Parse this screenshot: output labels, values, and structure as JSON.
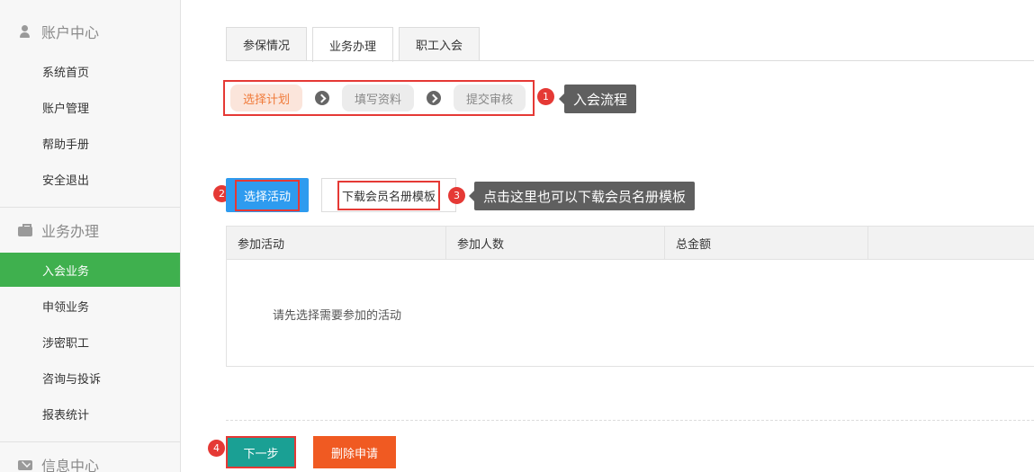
{
  "sidebar": {
    "sections": [
      {
        "title": "账户中心",
        "icon": "user-icon",
        "items": [
          "系统首页",
          "账户管理",
          "帮助手册",
          "安全退出"
        ]
      },
      {
        "title": "业务办理",
        "icon": "briefcase-icon",
        "items": [
          "入会业务",
          "申领业务",
          "涉密职工",
          "咨询与投诉",
          "报表统计"
        ],
        "active_item": "入会业务"
      },
      {
        "title": "信息中心",
        "icon": "envelope-icon",
        "items": []
      }
    ]
  },
  "tabs": [
    {
      "label": "参保情况",
      "active": false
    },
    {
      "label": "业务办理",
      "active": true
    },
    {
      "label": "职工入会",
      "active": false
    }
  ],
  "flow": {
    "steps": [
      "选择计划",
      "填写资料",
      "提交审核"
    ],
    "current_step": "选择计划"
  },
  "annotations": {
    "badge_1": "1",
    "tip_1": "入会流程",
    "badge_2": "2",
    "badge_3": "3",
    "tip_3": "点击这里也可以下载会员名册模板",
    "badge_4": "4"
  },
  "actions": {
    "select_activity": "选择活动",
    "download_template": "下载会员名册模板"
  },
  "table": {
    "columns": [
      "参加活动",
      "参加人数",
      "总金额",
      ""
    ],
    "empty_text": "请先选择需要参加的活动"
  },
  "footer": {
    "next": "下一步",
    "delete": "删除申请"
  },
  "colors": {
    "active_green": "#3fb04e",
    "primary_blue": "#2e9bef",
    "next_teal": "#1aa094",
    "delete_orange": "#f05a22",
    "annotation_red": "#e53935",
    "tip_gray": "#5f5f5f"
  }
}
